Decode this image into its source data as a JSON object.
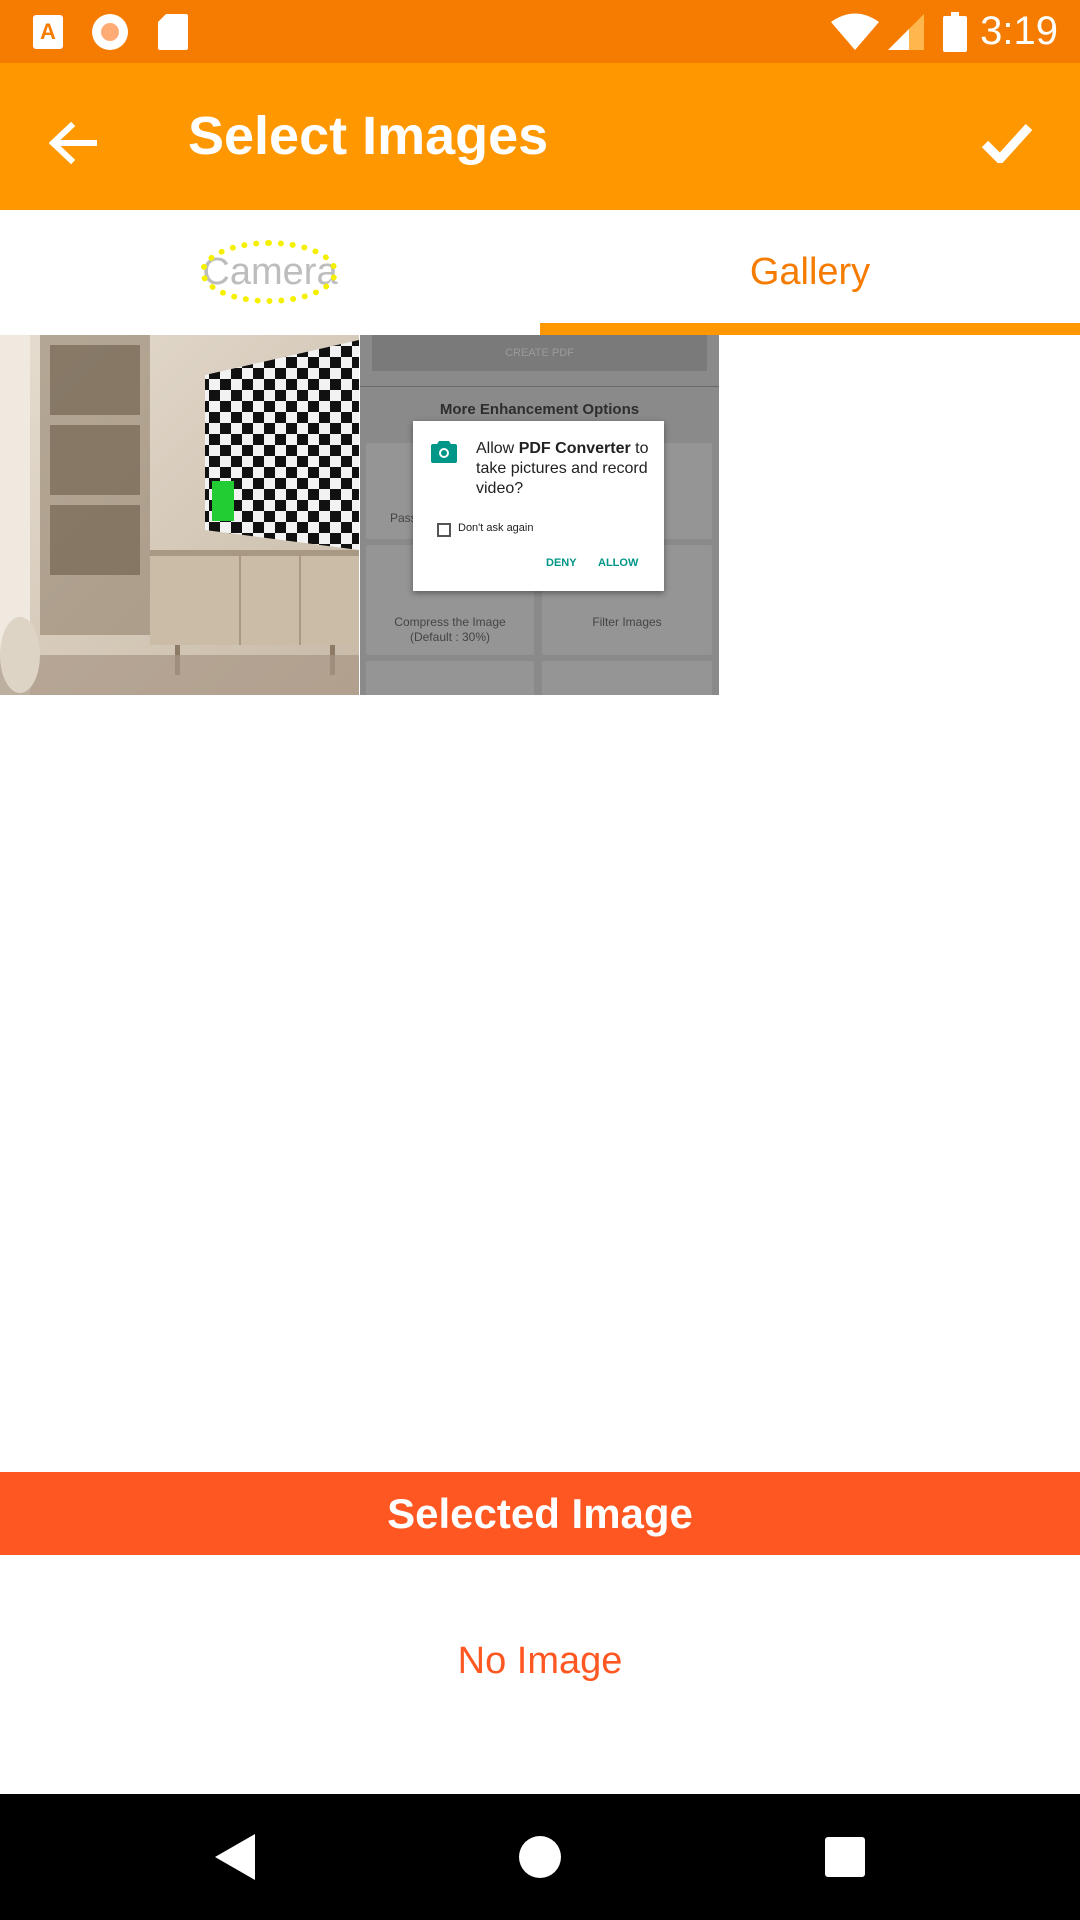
{
  "status_bar": {
    "time": "3:19",
    "left_icons": [
      "text-a-icon",
      "record-icon",
      "sd-card-icon"
    ],
    "right_icons": [
      "wifi-icon",
      "signal-icon",
      "battery-icon"
    ]
  },
  "app_bar": {
    "title": "Select Images",
    "back_icon": "arrow-back-icon",
    "done_icon": "check-icon"
  },
  "tabs": [
    {
      "label": "Camera",
      "selected": false
    },
    {
      "label": "Gallery",
      "selected": true
    }
  ],
  "gallery": {
    "thumb2": {
      "header_button": "CREATE PDF",
      "section_title": "More Enhancement Options",
      "partial_label": "Pass",
      "option_compress": "Compress the Image",
      "option_compress_default": "(Default : 30%)",
      "option_filter": "Filter Images",
      "dialog": {
        "text_prefix": "Allow ",
        "app_name": "PDF Converter",
        "text_suffix": " to take pictures and record video?",
        "checkbox_label": "Don't ask again",
        "deny": "DENY",
        "allow": "ALLOW"
      }
    }
  },
  "selected": {
    "header": "Selected Image",
    "empty_text": "No Image"
  },
  "colors": {
    "status_bar": "#f57c00",
    "app_bar": "#ff9800",
    "accent": "#ff5722",
    "tab_active": "#f57c00"
  }
}
